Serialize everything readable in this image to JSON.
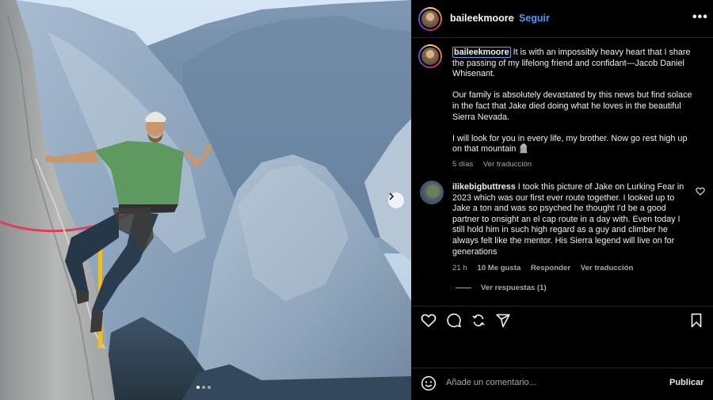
{
  "post": {
    "photo_alt": "",
    "carousel": {
      "count": 3,
      "active": 1
    }
  },
  "header": {
    "username": "baileekmoore",
    "separator": "•",
    "follow_label": "Seguir",
    "more_icon": "more-horizontal-icon",
    "more_label": "•••"
  },
  "caption": {
    "username": "baileekmoore",
    "para1": " It is with an impossibly heavy heart that I share the passing of my lifelong friend and confidant—Jacob Daniel Whisenant.",
    "para2": "Our family is absolutely devastated by this news but find solace in the fact that Jake died doing what he loves in the beautiful Sierra Nevada.",
    "para3": "I will look for you in every life, my brother. Now go rest high up on that mountain 🪦",
    "time": "5 días",
    "translate": "Ver traducción"
  },
  "comment": {
    "username": "ilikebigbuttress",
    "text": " I took this picture of Jake on Lurking Fear in 2023 which was our first ever route together. I looked up to Jake a ton and was so psyched he thought I'd be a good partner to onsight an el cap route in a day with. Even today I still hold him in such high regard as a guy and climber he always felt like the mentor. His Sierra legend will live on for generations",
    "time": "21 h",
    "likes": "10 Me gusta",
    "reply": "Responder",
    "translate": "Ver traducción",
    "view_replies": "Ver respuestas (1)"
  },
  "actions": {
    "icons": [
      "heart-icon",
      "comment-icon",
      "share-icon",
      "send-icon",
      "bookmark-icon"
    ]
  },
  "composer": {
    "placeholder": "Añade un comentario...",
    "publish_label": "Publicar",
    "emoji_icon": "emoji-icon"
  },
  "colors": {
    "accent": "#4a9cf6",
    "background": "#000000",
    "muted": "#a8a8a8"
  }
}
